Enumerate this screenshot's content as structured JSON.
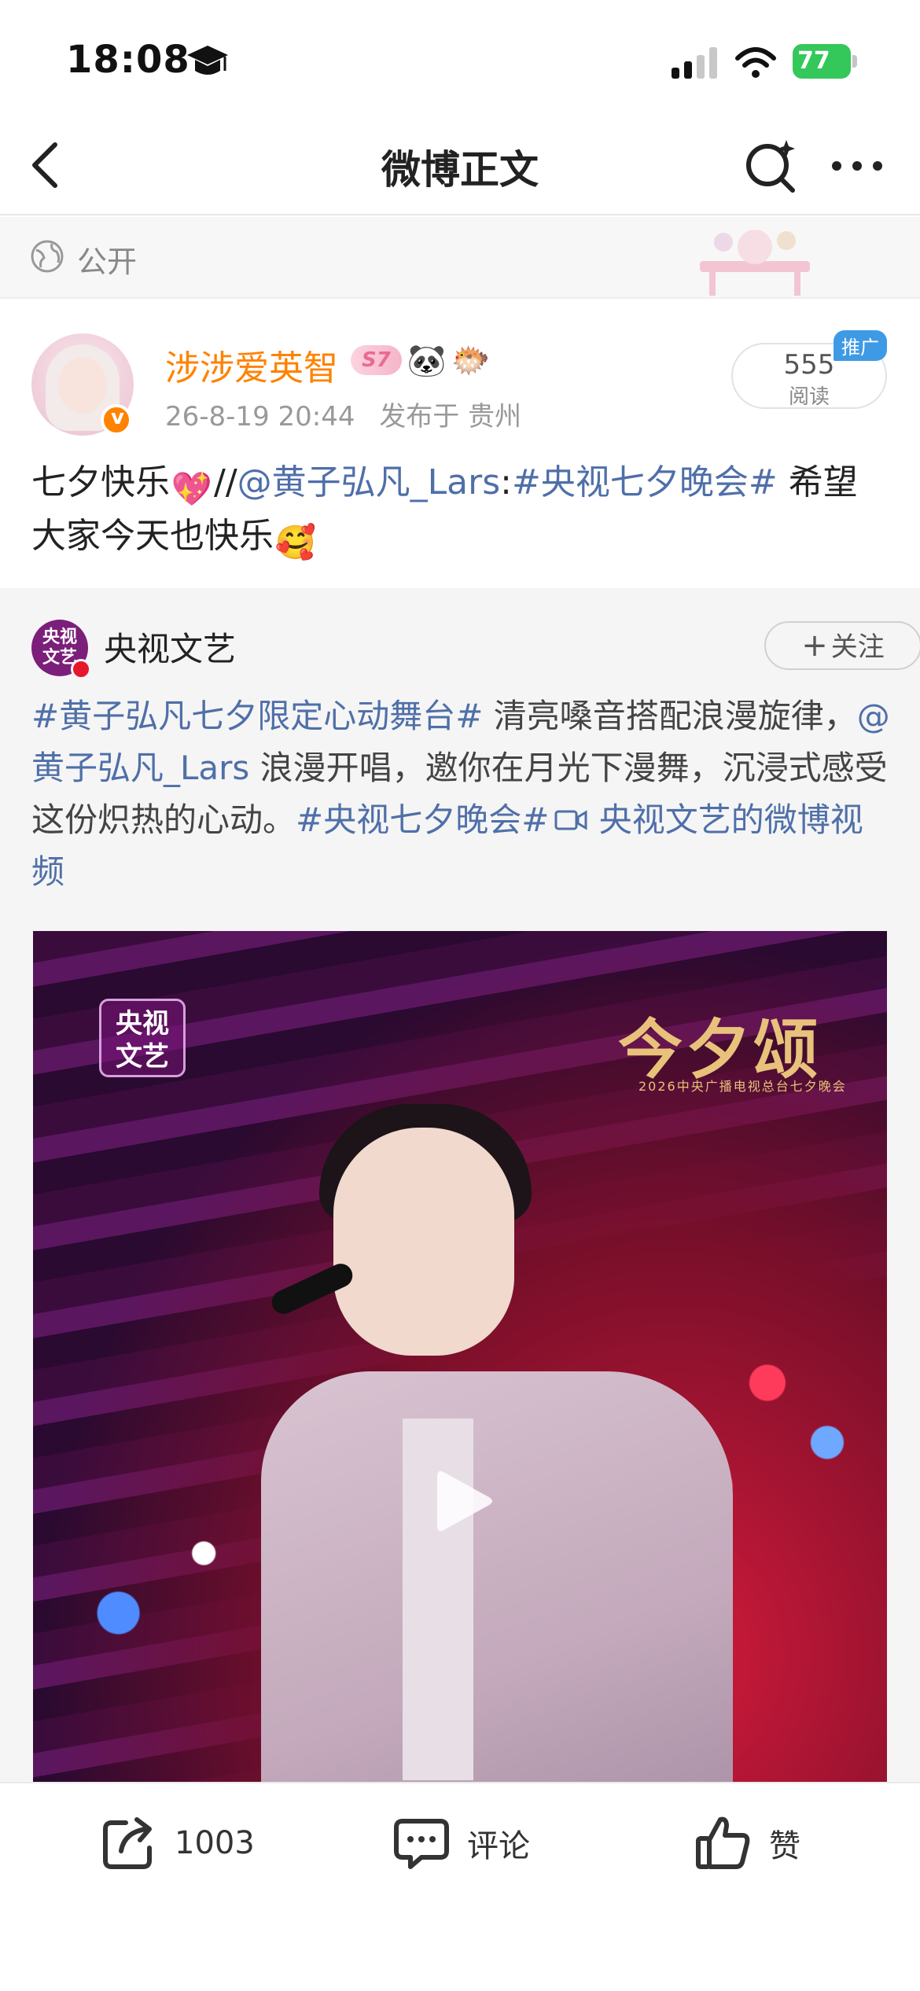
{
  "status_bar": {
    "time": "18:08",
    "battery": "77"
  },
  "nav": {
    "title": "微博正文"
  },
  "visibility": {
    "label": "公开"
  },
  "post": {
    "username": "涉涉爱英智",
    "badge_text": "S7",
    "timestamp": "26-8-19 20:44",
    "location": "发布于 贵州",
    "read_count": "555",
    "read_label": "阅读",
    "promo_label": "推广",
    "text_lead": "七夕快乐",
    "text_sep": "//",
    "mention": "@黄子弘凡_Lars",
    "colon": ":",
    "hashtag": "#央视七夕晚会#",
    "text_tail": " 希望大家今天也快乐"
  },
  "repost": {
    "author": "央视文艺",
    "avatar_text": "央视\n文艺",
    "follow_label": "关注",
    "hashtag1": "#黄子弘凡七夕限定心动舞台#",
    "text1": " 清亮嗓音搭配浪漫旋律，",
    "mention": "@黄子弘凡_Lars",
    "text2": " 浪漫开唱，邀你在月光下漫舞，沉浸式感受这份炽热的心动。",
    "hashtag2": "#央视七夕晚会#",
    "video_link": " 央视文艺的微博视频",
    "video": {
      "logo_text": "央视\n文艺",
      "title": "今夕颂",
      "subtitle": "2026中央广播电视总台七夕晚会"
    }
  },
  "actions": {
    "share_count": "1003",
    "comment_label": "评论",
    "like_label": "赞"
  },
  "colors": {
    "accent_orange": "#ff8200",
    "link_blue": "#4f6fa8",
    "promo_blue": "#3f9ae6"
  }
}
